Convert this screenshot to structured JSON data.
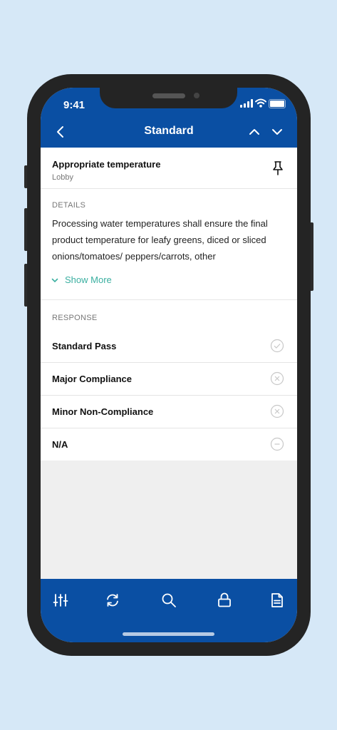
{
  "status_bar": {
    "time": "9:41"
  },
  "nav": {
    "title": "Standard",
    "icons": [
      "chevron-left-icon",
      "chevron-up-icon",
      "chevron-down-icon"
    ]
  },
  "question": {
    "title": "Appropriate temperature",
    "location": "Lobby",
    "pin_icon": "pin-icon"
  },
  "details": {
    "label": "DETAILS",
    "text": "Processing water temperatures  shall ensure the final product temperature for leafy greens, diced or sliced onions/tomatoes/ peppers/carrots, other",
    "show_more_label": "Show More"
  },
  "response": {
    "label": "RESPONSE",
    "options": [
      {
        "label": "Standard Pass",
        "icon": "check-circle-icon"
      },
      {
        "label": "Major Compliance",
        "icon": "x-circle-icon"
      },
      {
        "label": "Minor Non-Compliance",
        "icon": "x-circle-icon"
      },
      {
        "label": "N/A",
        "icon": "minus-circle-icon"
      }
    ]
  },
  "tab_bar": {
    "icons": [
      "sliders-icon",
      "sync-icon",
      "search-icon",
      "lock-icon",
      "document-icon"
    ]
  },
  "colors": {
    "brand": "#0a4fa3",
    "accent": "#3aafa0",
    "background": "#d6e8f7"
  }
}
